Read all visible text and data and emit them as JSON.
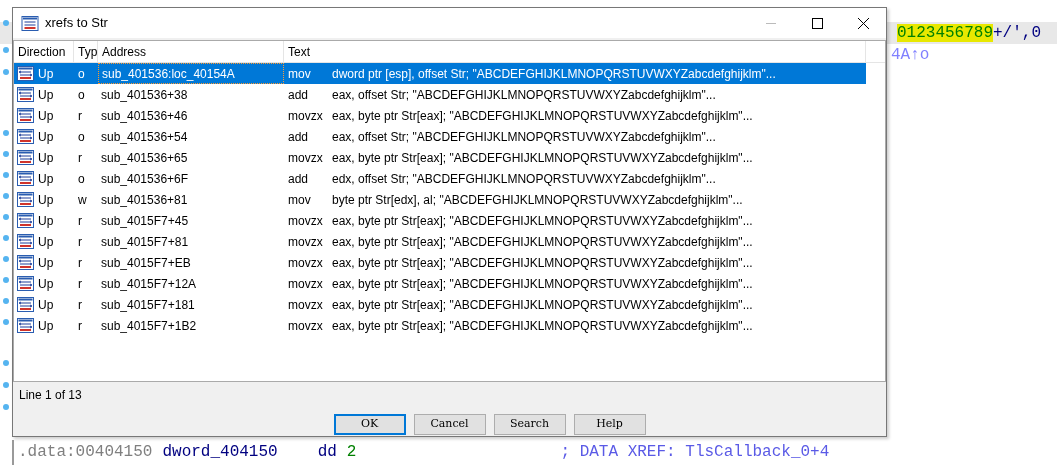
{
  "background": {
    "string_tail": {
      "highlighted": "0123456789",
      "rest": "+/',0"
    },
    "xref_tail": "4A↑o",
    "bottom_line": {
      "address": ".data:00404150",
      "name": "dword_404150",
      "instruction": "dd",
      "operand": "2",
      "comment": "; DATA XREF: TlsCallback_0+4"
    }
  },
  "dialog": {
    "title": "xrefs to Str",
    "columns": [
      "Direction",
      "Typ",
      "Address",
      "Text"
    ],
    "rows": [
      {
        "direction": "Up",
        "type": "o",
        "address": "sub_401536:loc_40154A",
        "mnemonic": "mov",
        "operands": "dword ptr [esp], offset Str; \"ABCDEFGHIJKLMNOPQRSTUVWXYZabcdefghijklm\"...",
        "selected": true
      },
      {
        "direction": "Up",
        "type": "o",
        "address": "sub_401536+38",
        "mnemonic": "add",
        "operands": "eax, offset Str; \"ABCDEFGHIJKLMNOPQRSTUVWXYZabcdefghijklm\"...",
        "selected": false
      },
      {
        "direction": "Up",
        "type": "r",
        "address": "sub_401536+46",
        "mnemonic": "movzx",
        "operands": "eax, byte ptr Str[eax]; \"ABCDEFGHIJKLMNOPQRSTUVWXYZabcdefghijklm\"...",
        "selected": false
      },
      {
        "direction": "Up",
        "type": "o",
        "address": "sub_401536+54",
        "mnemonic": "add",
        "operands": "eax, offset Str; \"ABCDEFGHIJKLMNOPQRSTUVWXYZabcdefghijklm\"...",
        "selected": false
      },
      {
        "direction": "Up",
        "type": "r",
        "address": "sub_401536+65",
        "mnemonic": "movzx",
        "operands": "eax, byte ptr Str[eax]; \"ABCDEFGHIJKLMNOPQRSTUVWXYZabcdefghijklm\"...",
        "selected": false
      },
      {
        "direction": "Up",
        "type": "o",
        "address": "sub_401536+6F",
        "mnemonic": "add",
        "operands": "edx, offset Str; \"ABCDEFGHIJKLMNOPQRSTUVWXYZabcdefghijklm\"...",
        "selected": false
      },
      {
        "direction": "Up",
        "type": "w",
        "address": "sub_401536+81",
        "mnemonic": "mov",
        "operands": "byte ptr Str[edx], al; \"ABCDEFGHIJKLMNOPQRSTUVWXYZabcdefghijklm\"...",
        "selected": false
      },
      {
        "direction": "Up",
        "type": "r",
        "address": "sub_4015F7+45",
        "mnemonic": "movzx",
        "operands": "eax, byte ptr Str[eax]; \"ABCDEFGHIJKLMNOPQRSTUVWXYZabcdefghijklm\"...",
        "selected": false
      },
      {
        "direction": "Up",
        "type": "r",
        "address": "sub_4015F7+81",
        "mnemonic": "movzx",
        "operands": "eax, byte ptr Str[eax]; \"ABCDEFGHIJKLMNOPQRSTUVWXYZabcdefghijklm\"...",
        "selected": false
      },
      {
        "direction": "Up",
        "type": "r",
        "address": "sub_4015F7+EB",
        "mnemonic": "movzx",
        "operands": "eax, byte ptr Str[eax]; \"ABCDEFGHIJKLMNOPQRSTUVWXYZabcdefghijklm\"...",
        "selected": false
      },
      {
        "direction": "Up",
        "type": "r",
        "address": "sub_4015F7+12A",
        "mnemonic": "movzx",
        "operands": "eax, byte ptr Str[eax]; \"ABCDEFGHIJKLMNOPQRSTUVWXYZabcdefghijklm\"...",
        "selected": false
      },
      {
        "direction": "Up",
        "type": "r",
        "address": "sub_4015F7+181",
        "mnemonic": "movzx",
        "operands": "eax, byte ptr Str[eax]; \"ABCDEFGHIJKLMNOPQRSTUVWXYZabcdefghijklm\"...",
        "selected": false
      },
      {
        "direction": "Up",
        "type": "r",
        "address": "sub_4015F7+1B2",
        "mnemonic": "movzx",
        "operands": "eax, byte ptr Str[eax]; \"ABCDEFGHIJKLMNOPQRSTUVWXYZabcdefghijklm\"...",
        "selected": false
      }
    ],
    "status": "Line 1 of 13",
    "buttons": [
      {
        "label": "OK",
        "default": true
      },
      {
        "label": "Cancel",
        "default": false
      },
      {
        "label": "Search",
        "default": false
      },
      {
        "label": "Help",
        "default": false
      }
    ]
  }
}
